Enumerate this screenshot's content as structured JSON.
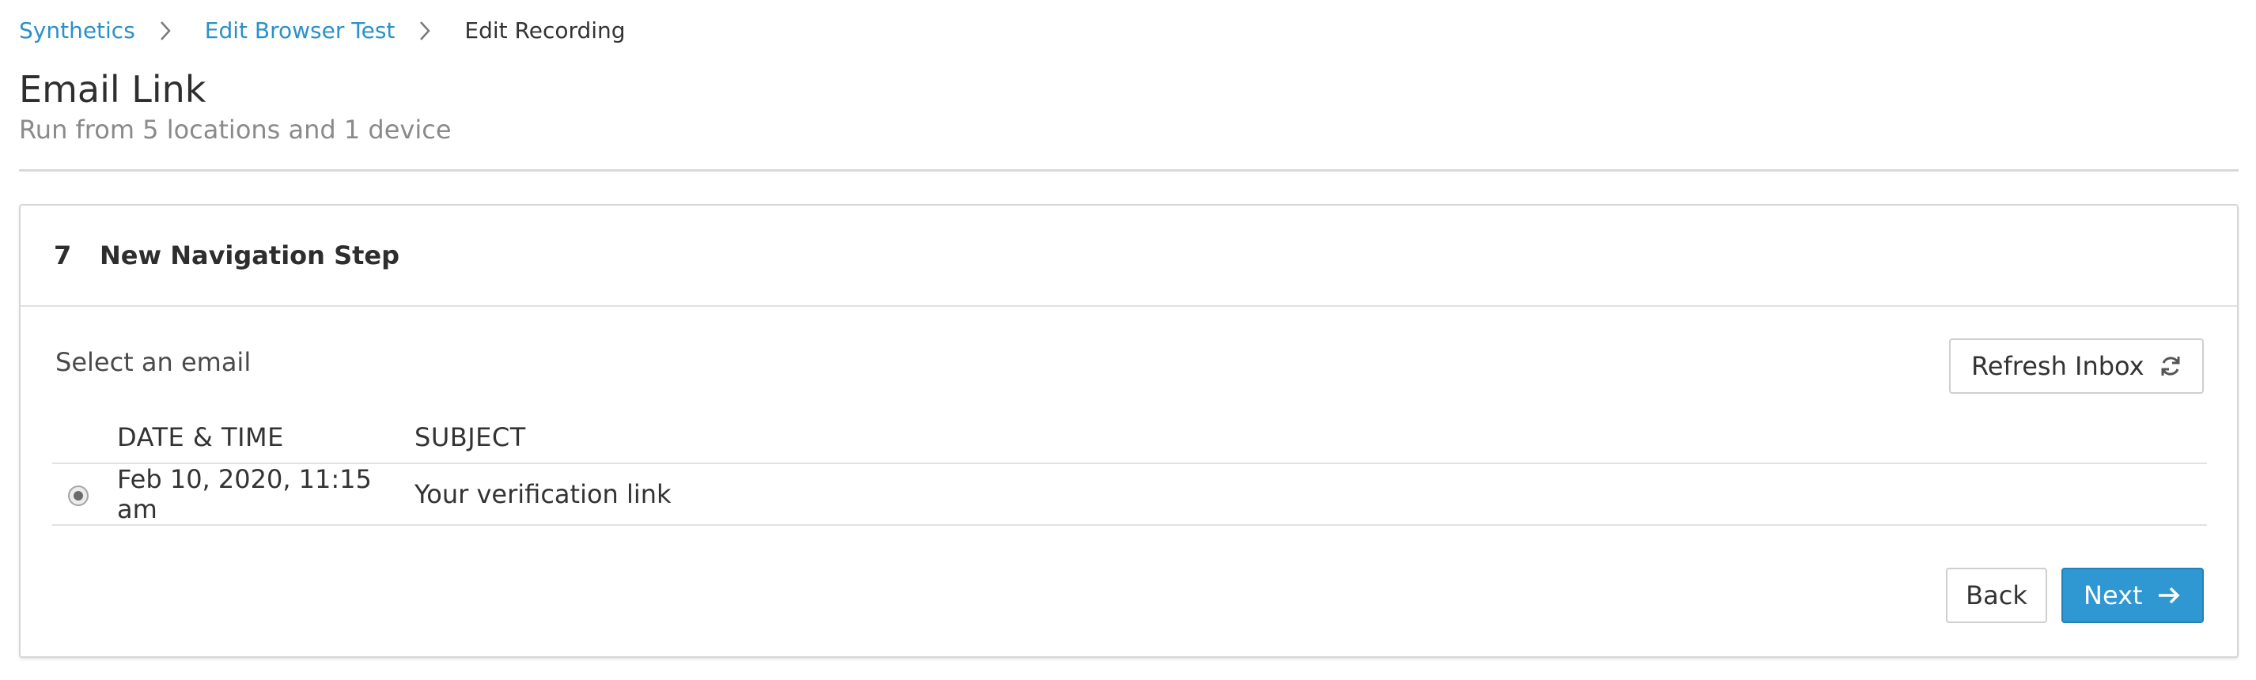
{
  "breadcrumb": {
    "items": [
      {
        "label": "Synthetics"
      },
      {
        "label": "Edit Browser Test"
      },
      {
        "label": "Edit Recording"
      }
    ]
  },
  "header": {
    "title": "Email Link",
    "subtitle": "Run from 5 locations and 1 device"
  },
  "panel": {
    "step_number": "7",
    "step_title": "New Navigation Step",
    "section_label": "Select an email",
    "refresh_label": "Refresh Inbox",
    "table": {
      "columns": [
        "DATE & TIME",
        "SUBJECT"
      ],
      "rows": [
        {
          "selected": true,
          "date": "Feb 10, 2020, 11:15 am",
          "subject": "Your verification link"
        }
      ]
    },
    "back_label": "Back",
    "next_label": "Next"
  },
  "icons": {
    "breadcrumb_separator": "chevron-right-icon",
    "refresh": "refresh-icon",
    "next": "arrow-right-icon"
  },
  "colors": {
    "link": "#2b91c9",
    "primary_button": "#2f97d1",
    "muted_text": "#8a8a8a"
  }
}
